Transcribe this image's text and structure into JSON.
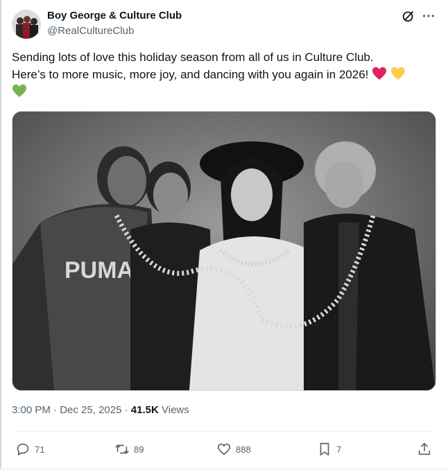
{
  "account": {
    "display_name": "Boy George & Culture Club",
    "handle": "@RealCultureClub"
  },
  "tweet": {
    "text_line1": "Sending lots of love this holiday season from all of us in Culture Club.",
    "text_line2": "Here’s to more music, more joy, and dancing with you again in 2026!",
    "emojis": [
      "red-heart",
      "yellow-heart",
      "green-heart"
    ]
  },
  "meta": {
    "time": "3:00 PM",
    "separator": "·",
    "date": "Dec 25, 2025",
    "views_count": "41.5K",
    "views_label": "Views"
  },
  "actions": {
    "replies": "71",
    "reposts": "89",
    "likes": "888",
    "bookmarks": "7"
  },
  "icons": {
    "header": [
      "grok-icon",
      "more-icon"
    ],
    "actions": [
      "reply-icon",
      "repost-icon",
      "like-icon",
      "bookmark-icon",
      "share-icon"
    ]
  },
  "colors": {
    "text": "#0f1419",
    "secondary": "#536471",
    "divider": "#eff3f4",
    "red_heart": "#e0245e",
    "yellow_heart": "#ffcc4d",
    "green_heart": "#77b255"
  }
}
